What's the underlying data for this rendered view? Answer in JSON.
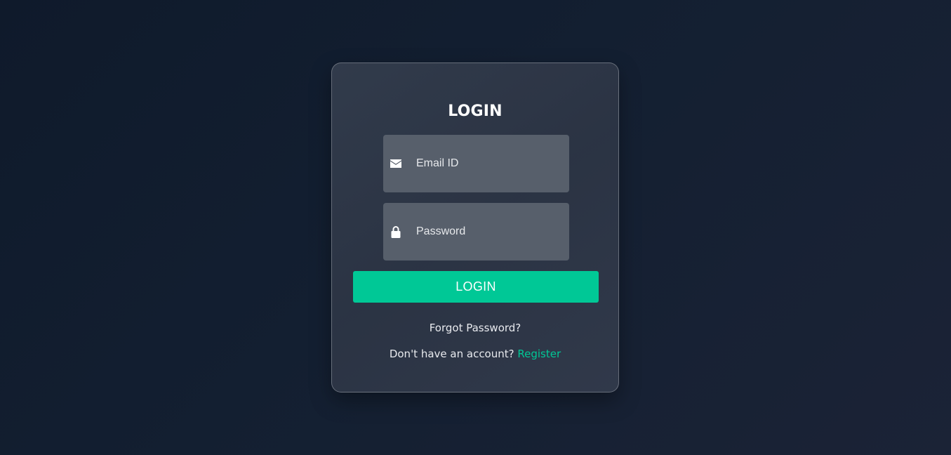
{
  "login_form": {
    "title": "LOGIN",
    "email": {
      "placeholder": "Email ID",
      "icon": "envelope-icon"
    },
    "password": {
      "placeholder": "Password",
      "icon": "lock-icon"
    },
    "submit_label": "LOGIN",
    "forgot_password": "Forgot Password?",
    "register_prompt": "Don't have an account?",
    "register_link": "Register"
  },
  "colors": {
    "accent": "#00c896",
    "background": "#131f31",
    "card": "#2c3545",
    "input": "#575f6b"
  }
}
